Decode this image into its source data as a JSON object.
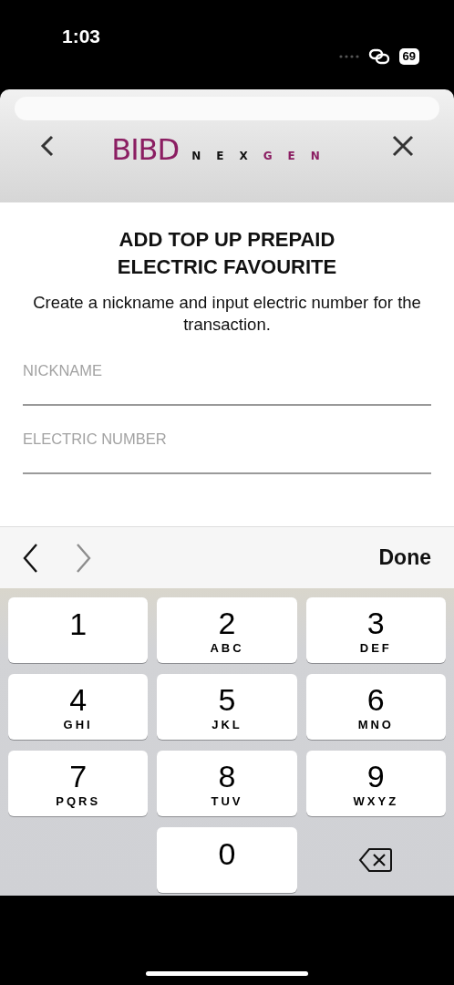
{
  "status_bar": {
    "time": "1:03",
    "battery": "69"
  },
  "header": {
    "brand": "BIBD",
    "suffix": [
      {
        "letter": "N",
        "color": "#111111"
      },
      {
        "letter": "E",
        "color": "#111111"
      },
      {
        "letter": "X",
        "color": "#111111"
      },
      {
        "letter": "G",
        "color": "#8b1e62"
      },
      {
        "letter": "E",
        "color": "#8b1e62"
      },
      {
        "letter": "N",
        "color": "#8b1e62"
      }
    ]
  },
  "title_lines": [
    "ADD TOP UP PREPAID",
    "ELECTRIC FAVOURITE"
  ],
  "description": "Create a nickname and input electric number for the transaction.",
  "fields": [
    {
      "placeholder": "NICKNAME"
    },
    {
      "placeholder": "ELECTRIC NUMBER"
    }
  ],
  "toolbar": {
    "previous_disabled": false,
    "next_disabled": true,
    "done": "Done"
  },
  "keys": [
    {
      "kind": "digit",
      "digit": "1"
    },
    {
      "kind": "digit",
      "digit": "2",
      "letters": "ABC"
    },
    {
      "kind": "digit",
      "digit": "3",
      "letters": "DEF"
    },
    {
      "kind": "digit",
      "digit": "4",
      "letters": "GHI"
    },
    {
      "kind": "digit",
      "digit": "5",
      "letters": "JKL"
    },
    {
      "kind": "digit",
      "digit": "6",
      "letters": "MNO"
    },
    {
      "kind": "digit",
      "digit": "7",
      "letters": "PQRS"
    },
    {
      "kind": "digit",
      "digit": "8",
      "letters": "TUV"
    },
    {
      "kind": "digit",
      "digit": "9",
      "letters": "WXYZ"
    },
    {
      "kind": "blank"
    },
    {
      "kind": "digit",
      "digit": "0"
    },
    {
      "kind": "delete"
    }
  ]
}
